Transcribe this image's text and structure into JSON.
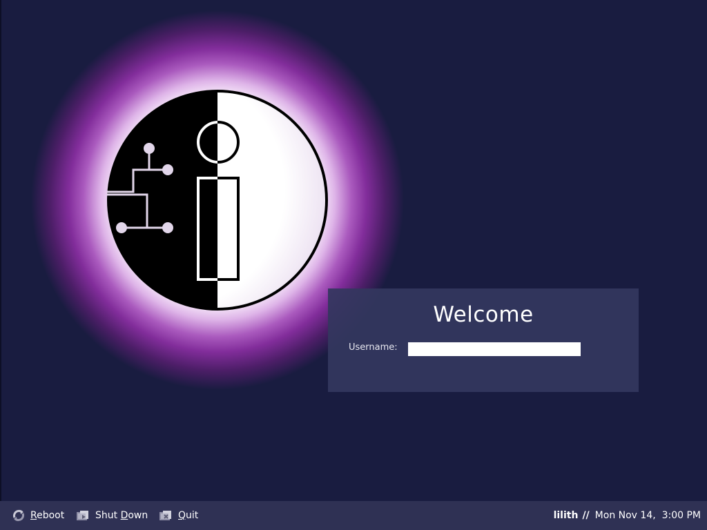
{
  "screen": {
    "background_color": "#191c40",
    "glow_color": "#8b2f9f"
  },
  "logo": {
    "icon": "circuit-i-logo-icon"
  },
  "login": {
    "title": "Welcome",
    "username_label": "Username:",
    "username_value": "",
    "panel_color": "#34375f"
  },
  "taskbar": {
    "background_color": "#2f3154",
    "buttons": [
      {
        "accesskey": "R",
        "rest": "eboot",
        "icon": "reboot-icon"
      },
      {
        "prefix": "Shut ",
        "accesskey": "D",
        "rest": "own",
        "icon": "shutdown-icon"
      },
      {
        "accesskey": "Q",
        "rest": "uit",
        "icon": "quit-icon"
      }
    ],
    "hostname": "lilith",
    "separator": "//",
    "clock": "Mon Nov 14,  3:00 PM"
  }
}
